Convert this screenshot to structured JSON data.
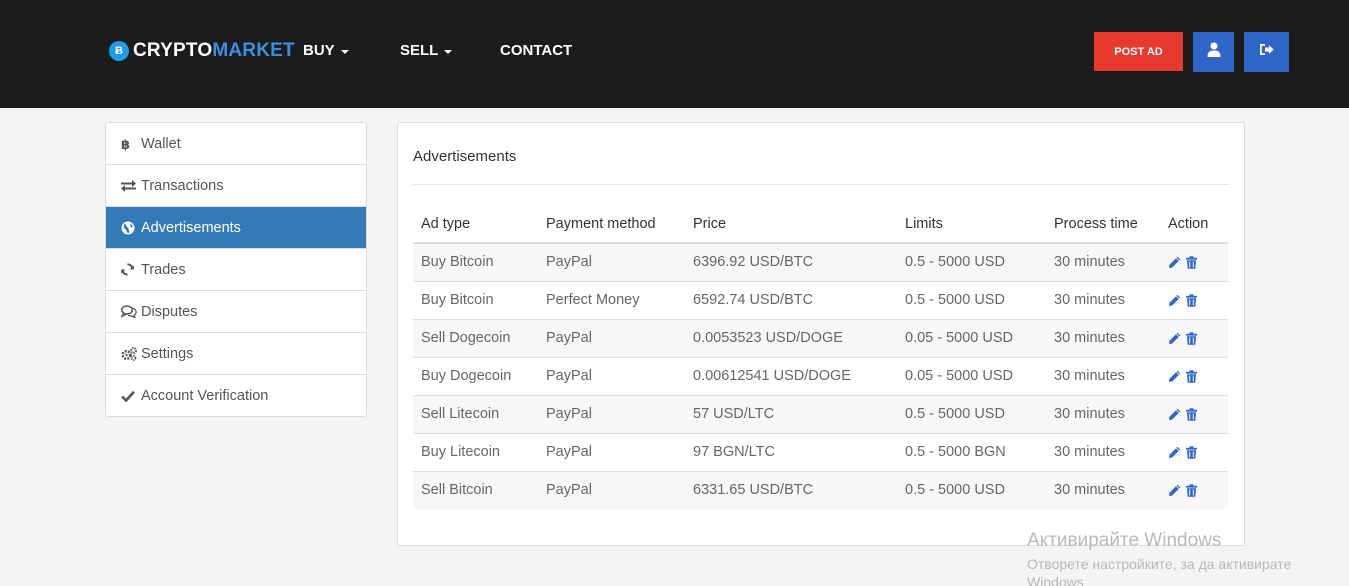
{
  "header": {
    "logo": {
      "coin_symbol": "Ƀ",
      "part1": "CRYPTO",
      "part2": "MARKET"
    },
    "nav": [
      {
        "label": "BUY",
        "has_dropdown": true
      },
      {
        "label": "SELL",
        "has_dropdown": true
      },
      {
        "label": "CONTACT",
        "has_dropdown": false
      }
    ],
    "post_ad_label": "POST AD",
    "profile_icon": "user-icon",
    "logout_icon": "sign-out-icon"
  },
  "sidebar": {
    "items": [
      {
        "label": "Wallet",
        "icon": "bitcoin-icon",
        "active": false
      },
      {
        "label": "Transactions",
        "icon": "exchange-icon",
        "active": false
      },
      {
        "label": "Advertisements",
        "icon": "globe-icon",
        "active": true
      },
      {
        "label": "Trades",
        "icon": "refresh-icon",
        "active": false
      },
      {
        "label": "Disputes",
        "icon": "comments-icon",
        "active": false
      },
      {
        "label": "Settings",
        "icon": "cogs-icon",
        "active": false
      },
      {
        "label": "Account Verification",
        "icon": "check-icon",
        "active": false
      }
    ]
  },
  "panel": {
    "title": "Advertisements",
    "columns": [
      "Ad type",
      "Payment method",
      "Price",
      "Limits",
      "Process time",
      "Action"
    ],
    "rows": [
      [
        "Buy Bitcoin",
        "PayPal",
        "6396.92 USD/BTC",
        "0.5 - 5000 USD",
        "30 minutes"
      ],
      [
        "Buy Bitcoin",
        "Perfect Money",
        "6592.74 USD/BTC",
        "0.5 - 5000 USD",
        "30 minutes"
      ],
      [
        "Sell Dogecoin",
        "PayPal",
        "0.0053523 USD/DOGE",
        "0.05 - 5000 USD",
        "30 minutes"
      ],
      [
        "Buy Dogecoin",
        "PayPal",
        "0.00612541 USD/DOGE",
        "0.05 - 5000 USD",
        "30 minutes"
      ],
      [
        "Sell Litecoin",
        "PayPal",
        "57 USD/LTC",
        "0.5 - 5000 USD",
        "30 minutes"
      ],
      [
        "Buy Litecoin",
        "PayPal",
        "97 BGN/LTC",
        "0.5 - 5000 BGN",
        "30 minutes"
      ],
      [
        "Sell Bitcoin",
        "PayPal",
        "6331.65 USD/BTC",
        "0.5 - 5000 USD",
        "30 minutes"
      ]
    ],
    "action_icons": [
      "pencil-icon",
      "trash-icon"
    ]
  },
  "watermark": {
    "title": "Активирайте Windows",
    "subtitle": "Отворете настройките, за да активирате Windows"
  },
  "colors": {
    "header_bg": "#1c1c1c",
    "accent_blue": "#337ab7",
    "button_blue": "#2f67c8",
    "post_ad_red": "#e8392f",
    "logo_blue": "#3b8fe0"
  }
}
